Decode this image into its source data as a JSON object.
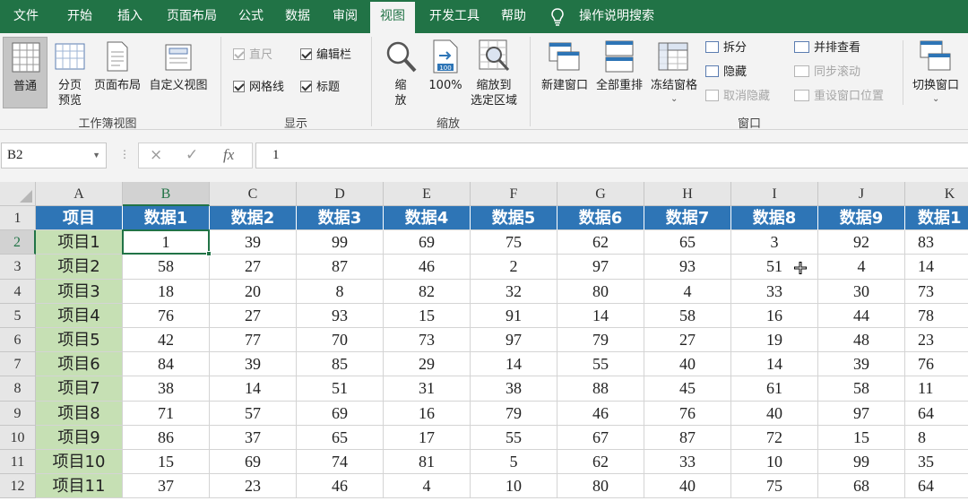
{
  "menu": {
    "tabs": [
      "文件",
      "开始",
      "插入",
      "页面布局",
      "公式",
      "数据",
      "审阅",
      "视图",
      "开发工具",
      "帮助"
    ],
    "active": "视图",
    "search_label": "操作说明搜索"
  },
  "ribbon": {
    "workbook_views": {
      "title": "工作簿视图",
      "normal": "普通",
      "page_break_line1": "分页",
      "page_break_line2": "预览",
      "page_layout": "页面布局",
      "custom_views": "自定义视图"
    },
    "show": {
      "title": "显示",
      "ruler": "直尺",
      "formula_bar": "编辑栏",
      "gridlines": "网格线",
      "headings": "标题"
    },
    "zoom": {
      "title": "缩放",
      "zoom_line1": "缩",
      "zoom_line2": "放",
      "zoom100": "100%",
      "zoom_sel_line1": "缩放到",
      "zoom_sel_line2": "选定区域"
    },
    "window": {
      "title": "窗口",
      "new_window": "新建窗口",
      "arrange_all": "全部重排",
      "freeze_panes": "冻结窗格",
      "split": "拆分",
      "hide": "隐藏",
      "unhide": "取消隐藏",
      "side_by_side": "并排查看",
      "sync_scroll": "同步滚动",
      "reset_position": "重设窗口位置",
      "switch_windows": "切换窗口"
    }
  },
  "formula_bar": {
    "name_box": "B2",
    "cancel_icon": "×",
    "enter_icon": "✓",
    "fx_label": "fx",
    "value": "1"
  },
  "sheet": {
    "columns": [
      "A",
      "B",
      "C",
      "D",
      "E",
      "F",
      "G",
      "H",
      "I",
      "J",
      "K"
    ],
    "selected_cell": "B2",
    "header_row": [
      "项目",
      "数据1",
      "数据2",
      "数据3",
      "数据4",
      "数据5",
      "数据6",
      "数据7",
      "数据8",
      "数据9",
      "数据1"
    ],
    "rows": [
      [
        "项目1",
        "1",
        "39",
        "99",
        "69",
        "75",
        "62",
        "65",
        "3",
        "92",
        "83"
      ],
      [
        "项目2",
        "58",
        "27",
        "87",
        "46",
        "2",
        "97",
        "93",
        "51",
        "4",
        "14"
      ],
      [
        "项目3",
        "18",
        "20",
        "8",
        "82",
        "32",
        "80",
        "4",
        "33",
        "30",
        "73"
      ],
      [
        "项目4",
        "76",
        "27",
        "93",
        "15",
        "91",
        "14",
        "58",
        "16",
        "44",
        "78"
      ],
      [
        "项目5",
        "42",
        "77",
        "70",
        "73",
        "97",
        "79",
        "27",
        "19",
        "48",
        "23"
      ],
      [
        "项目6",
        "84",
        "39",
        "85",
        "29",
        "14",
        "55",
        "40",
        "14",
        "39",
        "76"
      ],
      [
        "项目7",
        "38",
        "14",
        "51",
        "31",
        "38",
        "88",
        "45",
        "61",
        "58",
        "11"
      ],
      [
        "项目8",
        "71",
        "57",
        "69",
        "16",
        "79",
        "46",
        "76",
        "40",
        "97",
        "64"
      ],
      [
        "项目9",
        "86",
        "37",
        "65",
        "17",
        "55",
        "67",
        "87",
        "72",
        "15",
        "8"
      ],
      [
        "项目10",
        "15",
        "69",
        "74",
        "81",
        "5",
        "62",
        "33",
        "10",
        "99",
        "35"
      ],
      [
        "项目11",
        "37",
        "23",
        "46",
        "4",
        "10",
        "80",
        "40",
        "75",
        "68",
        "64"
      ]
    ]
  },
  "colors": {
    "ribbon_green": "#217346",
    "header_blue": "#2e75b6",
    "label_green": "#c6e0b4"
  }
}
